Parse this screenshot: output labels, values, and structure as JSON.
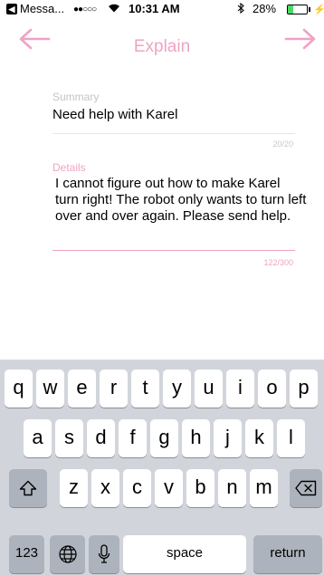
{
  "status_bar": {
    "back_app_label": "Messa...",
    "signal": "●●○○○",
    "time": "10:31 AM",
    "battery_percent": "28%",
    "battery_level": 0.28
  },
  "nav": {
    "title": "Explain",
    "accent_color": "#f0a3c4"
  },
  "form": {
    "summary": {
      "label": "Summary",
      "value": "Need help with Karel",
      "counter": "20/20"
    },
    "details": {
      "label": "Details",
      "value": "I cannot figure out how to make Karel turn right! The robot only wants to turn left over and over again. Please send help.",
      "counter": "122/300"
    }
  },
  "keyboard": {
    "row1": [
      "q",
      "w",
      "e",
      "r",
      "t",
      "y",
      "u",
      "i",
      "o",
      "p"
    ],
    "row2": [
      "a",
      "s",
      "d",
      "f",
      "g",
      "h",
      "j",
      "k",
      "l"
    ],
    "row3": [
      "z",
      "x",
      "c",
      "v",
      "b",
      "n",
      "m"
    ],
    "numbers_label": "123",
    "space_label": "space",
    "return_label": "return"
  }
}
